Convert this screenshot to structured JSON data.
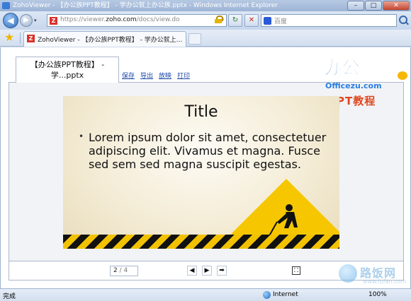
{
  "window": {
    "title": "ZohoViewer - 【办公族PPT教程】 - 学办公就上办公族.pptx - Windows Internet Explorer",
    "minimize": "–",
    "maximize": "□",
    "close": "✕"
  },
  "addressbar": {
    "url_prefix": "https://viewer.",
    "url_domain": "zoho.com",
    "url_path": "/docs/view.do",
    "back_glyph": "◀",
    "forward_glyph": "▶",
    "refresh_glyph": "↻",
    "stop_glyph": "✕",
    "dropdown": "▾",
    "search_placeholder": "百度"
  },
  "tabs": {
    "favicon": "Z",
    "active_title": "ZohoViewer - 【办公族PPT教程】 - 学办公就上..."
  },
  "document": {
    "tab_title_line1": "【办公族PPT教程】 -",
    "tab_title_line2": "学...pptx",
    "actions": [
      "保存",
      "导出",
      "放映",
      "打印"
    ]
  },
  "brand": {
    "cn": "办公族",
    "en": "Officezu.com",
    "ppt": "PPT教程"
  },
  "slide": {
    "title": "Title",
    "bullet": "•",
    "body": "Lorem ipsum dolor sit amet, consectetuer adipiscing elit. Vivamus et magna. Fusce sed sem sed magna suscipit egestas."
  },
  "pager": {
    "current": "2",
    "total": "/ 4",
    "prev_glyph": "◀",
    "play_glyph": "▶",
    "next_glyph": "➡",
    "fullscreen_glyph": "⛶"
  },
  "statusbar": {
    "status": "完成",
    "zone": "Internet",
    "zoom": "100%"
  },
  "watermark": {
    "text": "路饭网",
    "sub": "www.lufan.com"
  }
}
